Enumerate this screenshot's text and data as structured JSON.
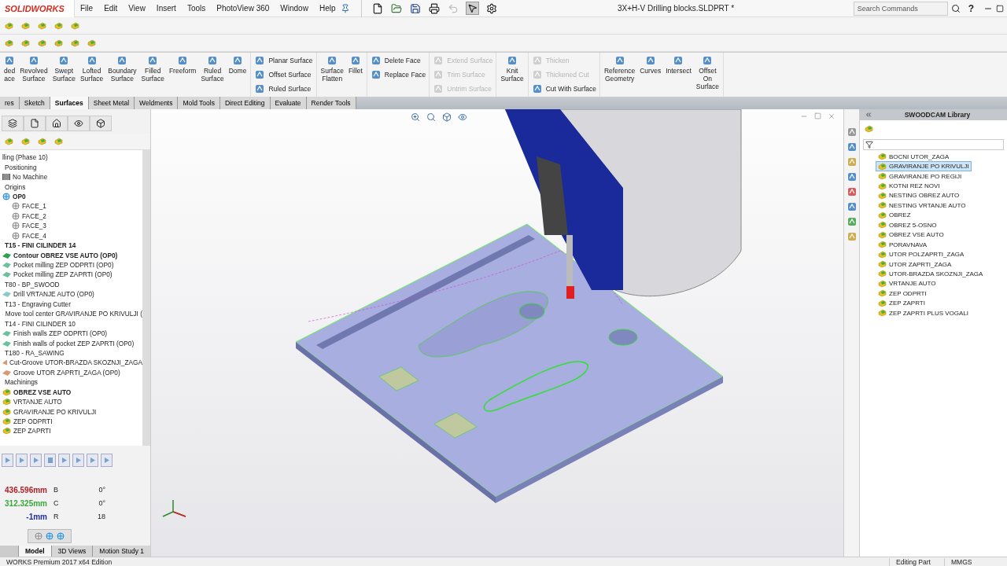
{
  "app": {
    "logo": "SOLIDWORKS",
    "menu": [
      "File",
      "Edit",
      "View",
      "Insert",
      "Tools",
      "PhotoView 360",
      "Window",
      "Help"
    ],
    "document_title": "3X+H-V Drilling blocks.SLDPRT *",
    "search": {
      "placeholder": "Search Commands"
    },
    "help": "?"
  },
  "ribbon": [
    {
      "kind": "large",
      "items": [
        {
          "label": "ded\nace",
          "disabled": false
        },
        {
          "label": "Revolved\nSurface",
          "disabled": false
        },
        {
          "label": "Swept\nSurface",
          "disabled": false
        },
        {
          "label": "Lofted\nSurface",
          "disabled": false
        },
        {
          "label": "Boundary\nSurface",
          "disabled": false
        },
        {
          "label": "Filled\nSurface",
          "disabled": false
        },
        {
          "label": "Freeform",
          "disabled": false
        },
        {
          "label": "Ruled\nSurface",
          "disabled": false
        },
        {
          "label": "Dome",
          "disabled": false
        }
      ]
    },
    {
      "kind": "stack",
      "items": [
        {
          "label": "Planar Surface",
          "disabled": false
        },
        {
          "label": "Offset Surface",
          "disabled": false
        },
        {
          "label": "Ruled Surface",
          "disabled": false
        }
      ]
    },
    {
      "kind": "large",
      "items": [
        {
          "label": "Surface\nFlatten",
          "disabled": false
        },
        {
          "label": "Fillet",
          "disabled": false
        }
      ]
    },
    {
      "kind": "stack",
      "items": [
        {
          "label": "Delete Face",
          "disabled": false
        },
        {
          "label": "Replace Face",
          "disabled": false
        }
      ]
    },
    {
      "kind": "stack",
      "items": [
        {
          "label": "Extend Surface",
          "disabled": true
        },
        {
          "label": "Trim Surface",
          "disabled": true
        },
        {
          "label": "Untrim Surface",
          "disabled": true
        }
      ]
    },
    {
      "kind": "large",
      "items": [
        {
          "label": "Knit\nSurface",
          "disabled": false
        }
      ]
    },
    {
      "kind": "stack",
      "items": [
        {
          "label": "Thicken",
          "disabled": true
        },
        {
          "label": "Thickened Cut",
          "disabled": true
        },
        {
          "label": "Cut With Surface",
          "disabled": false
        }
      ]
    },
    {
      "kind": "large",
      "items": [
        {
          "label": "Reference\nGeometry",
          "disabled": false
        },
        {
          "label": "Curves",
          "disabled": false
        },
        {
          "label": "Intersect",
          "disabled": false
        },
        {
          "label": "Offset\nOn\nSurface",
          "disabled": false
        }
      ]
    }
  ],
  "ribbon_tabs": [
    {
      "label": "res",
      "selected": false
    },
    {
      "label": "Sketch",
      "selected": false
    },
    {
      "label": "Surfaces",
      "selected": true
    },
    {
      "label": "Sheet Metal",
      "selected": false
    },
    {
      "label": "Weldments",
      "selected": false
    },
    {
      "label": "Mold Tools",
      "selected": false
    },
    {
      "label": "Direct Editing",
      "selected": false
    },
    {
      "label": "Evaluate",
      "selected": false
    },
    {
      "label": "Render Tools",
      "selected": false
    }
  ],
  "feature_tree": {
    "items": [
      {
        "label": "lling  (Phase 10)",
        "kind": "none",
        "bold": false,
        "children": [
          {
            "label": "Positioning",
            "kind": "none",
            "bold": false
          },
          {
            "label": "No Machine",
            "kind": "machine",
            "bold": false
          },
          {
            "label": "Origins",
            "kind": "none",
            "bold": false
          },
          {
            "label": "OP0",
            "kind": "origin",
            "bold": true,
            "children": [
              {
                "label": "FACE_1",
                "kind": "face",
                "bold": false
              },
              {
                "label": "FACE_2",
                "kind": "face",
                "bold": false
              },
              {
                "label": "FACE_3",
                "kind": "face",
                "bold": false
              },
              {
                "label": "FACE_4",
                "kind": "face",
                "bold": false
              }
            ]
          },
          {
            "label": "T15 - FINI CILINDER 14",
            "kind": "none",
            "bold": true
          },
          {
            "label": "Contour OBREZ VSE AUTO  (OP0)",
            "kind": "contour",
            "bold": true
          },
          {
            "label": "Pocket milling ZEP ODPRTI  (OP0)",
            "kind": "pocket",
            "bold": false
          },
          {
            "label": "Pocket milling ZEP ZAPRTI  (OP0)",
            "kind": "pocket",
            "bold": false
          },
          {
            "label": "T80 - BP_SWOOD",
            "kind": "none",
            "bold": false
          },
          {
            "label": "Drill VRTANJE AUTO  (OP0)",
            "kind": "drill",
            "bold": false
          },
          {
            "label": "T13 - Engraving Cutter",
            "kind": "none",
            "bold": false
          },
          {
            "label": "Move tool center GRAVIRANJE PO KRIVULJI  (",
            "kind": "drill",
            "bold": false
          },
          {
            "label": "T14 - FINI CILINDER 10",
            "kind": "none",
            "bold": false
          },
          {
            "label": "Finish walls ZEP ODPRTI  (OP0)",
            "kind": "pocket",
            "bold": false
          },
          {
            "label": "Finish walls of pocket ZEP ZAPRTI  (OP0)",
            "kind": "pocket",
            "bold": false
          },
          {
            "label": "T180 - RA_SAWING",
            "kind": "none",
            "bold": false
          },
          {
            "label": "Cut-Groove UTOR-BRAZDA SKOZNJI_ZAGA",
            "kind": "saw",
            "bold": false
          },
          {
            "label": "Groove UTOR ZAPRTI_ZAGA  (OP0)",
            "kind": "saw",
            "bold": false
          },
          {
            "label": "Machinings",
            "kind": "none",
            "bold": false
          },
          {
            "label": "OBREZ VSE AUTO",
            "kind": "machining",
            "bold": true
          },
          {
            "label": "VRTANJE AUTO",
            "kind": "machining",
            "bold": false
          },
          {
            "label": "GRAVIRANJE PO KRIVULJI",
            "kind": "machining",
            "bold": false
          },
          {
            "label": "ZEP ODPRTI",
            "kind": "machining",
            "bold": false
          },
          {
            "label": "ZEP ZAPRTI",
            "kind": "machining",
            "bold": false
          }
        ]
      }
    ]
  },
  "readouts": [
    {
      "value": "436.596mm",
      "color": "#b0202a",
      "axis": "B",
      "angle": "0°"
    },
    {
      "value": "312.325mm",
      "color": "#3aa83a",
      "axis": "C",
      "angle": "0°"
    },
    {
      "value": "-1mm",
      "color": "#2030a0",
      "axis": "R",
      "angle": "18"
    }
  ],
  "bottom_tabs": [
    {
      "label": "Model",
      "selected": true
    },
    {
      "label": "3D Views",
      "selected": false
    },
    {
      "label": "Motion Study 1",
      "selected": false
    }
  ],
  "library": {
    "title": "SWOODCAM Library",
    "items": [
      {
        "label": "BOCNI UTOR_ZAGA",
        "selected": false
      },
      {
        "label": "GRAVIRANJE PO KRIVULJI",
        "selected": true
      },
      {
        "label": "GRAVIRANJE PO REGIJI",
        "selected": false
      },
      {
        "label": "KOTNI REZ NOVI",
        "selected": false
      },
      {
        "label": "NESTING OBREZ AUTO",
        "selected": false
      },
      {
        "label": "NESTING VRTANJE AUTO",
        "selected": false
      },
      {
        "label": "OBREZ",
        "selected": false
      },
      {
        "label": "OBREZ 5-OSNO",
        "selected": false
      },
      {
        "label": "OBREZ VSE AUTO",
        "selected": false
      },
      {
        "label": "PORAVNAVA",
        "selected": false
      },
      {
        "label": "UTOR POLZAPRTI_ZAGA",
        "selected": false
      },
      {
        "label": "UTOR ZAPRTI_ZAGA",
        "selected": false
      },
      {
        "label": "UTOR-BRAZDA SKOZNJI_ZAGA",
        "selected": false
      },
      {
        "label": "VRTANJE AUTO",
        "selected": false
      },
      {
        "label": "ZEP ODPRTI",
        "selected": false
      },
      {
        "label": "ZEP ZAPRTI",
        "selected": false
      },
      {
        "label": "ZEP ZAPRTI PLUS VOGALI",
        "selected": false
      }
    ]
  },
  "status_bar": {
    "edition": "WORKS Premium 2017 x64 Edition",
    "mode": "Editing Part",
    "units": "MMGS"
  }
}
